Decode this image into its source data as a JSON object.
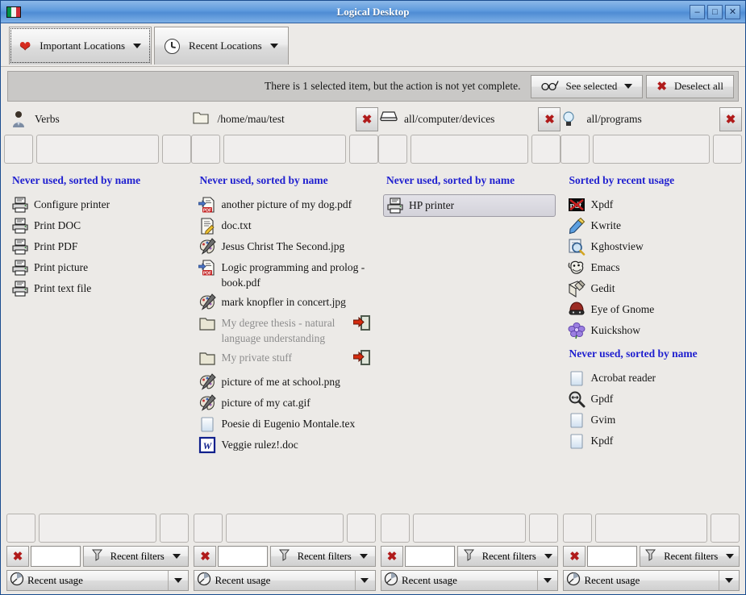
{
  "window": {
    "title": "Logical Desktop",
    "title_icon": "italian-flag-icon",
    "minimize": "–",
    "maximize": "□",
    "close": "✕"
  },
  "tabs": [
    {
      "label": "Important Locations",
      "icon": "heart-icon",
      "focused": true
    },
    {
      "label": "Recent Locations",
      "icon": "clock-icon",
      "focused": false
    }
  ],
  "status": {
    "message": "There is 1 selected item, but the action is not yet complete.",
    "see_selected": "See selected",
    "see_selected_icon": "glasses-icon",
    "deselect_all": "Deselect all",
    "deselect_icon": "red-x-icon"
  },
  "columns": [
    {
      "header": "Verbs",
      "header_icon": "user-icon",
      "has_close": false,
      "sections": [
        {
          "title": "Never used, sorted by name",
          "items": [
            {
              "label": "Configure printer",
              "icon": "printer-icon"
            },
            {
              "label": "Print DOC",
              "icon": "printer-icon"
            },
            {
              "label": "Print PDF",
              "icon": "printer-icon"
            },
            {
              "label": "Print picture",
              "icon": "printer-icon"
            },
            {
              "label": "Print text file",
              "icon": "printer-icon"
            }
          ]
        }
      ]
    },
    {
      "header": "/home/mau/test",
      "header_icon": "folder-icon",
      "has_close": true,
      "sections": [
        {
          "title": "Never used, sorted by name",
          "items": [
            {
              "label": "another picture of my dog.pdf",
              "icon": "pdf-icon"
            },
            {
              "label": "doc.txt",
              "icon": "text-edit-icon"
            },
            {
              "label": "Jesus Christ The Second.jpg",
              "icon": "palette-icon"
            },
            {
              "label": "Logic programming and prolog - book.pdf",
              "icon": "pdf-icon"
            },
            {
              "label": "mark knopfler in concert.jpg",
              "icon": "palette-icon"
            },
            {
              "label": "My degree thesis - natural language understanding",
              "icon": "folder-icon",
              "dim": true,
              "side_icon": "enter-folder-icon"
            },
            {
              "label": "My private stuff",
              "icon": "folder-icon",
              "dim": true,
              "side_icon": "enter-folder-icon"
            },
            {
              "label": "picture of me at school.png",
              "icon": "palette-icon"
            },
            {
              "label": "picture of my cat.gif",
              "icon": "palette-icon"
            },
            {
              "label": "Poesie di Eugenio Montale.tex",
              "icon": "blank-doc-icon"
            },
            {
              "label": "Veggie rulez!.doc",
              "icon": "word-icon"
            }
          ]
        }
      ]
    },
    {
      "header": "all/computer/devices",
      "header_icon": "disk-icon",
      "has_close": true,
      "sections": [
        {
          "title": "Never used, sorted by name",
          "items": [
            {
              "label": "HP printer",
              "icon": "printer-icon",
              "selected": true
            }
          ]
        }
      ]
    },
    {
      "header": "all/programs",
      "header_icon": "lightbulb-icon",
      "has_close": true,
      "sections": [
        {
          "title": "Sorted by recent usage",
          "items": [
            {
              "label": "Xpdf",
              "icon": "xpdf-icon"
            },
            {
              "label": "Kwrite",
              "icon": "kwrite-icon"
            },
            {
              "label": "Kghostview",
              "icon": "kghostview-icon"
            },
            {
              "label": "Emacs",
              "icon": "emacs-gnu-icon"
            },
            {
              "label": "Gedit",
              "icon": "gedit-icon"
            },
            {
              "label": "Eye of Gnome",
              "icon": "eog-icon"
            },
            {
              "label": "Kuickshow",
              "icon": "kuickshow-icon"
            }
          ]
        },
        {
          "title": "Never used, sorted by name",
          "items": [
            {
              "label": "Acrobat reader",
              "icon": "blank-doc-icon"
            },
            {
              "label": "Gpdf",
              "icon": "magnifier-icon"
            },
            {
              "label": "Gvim",
              "icon": "blank-doc-icon"
            },
            {
              "label": "Kpdf",
              "icon": "blank-doc-icon"
            }
          ]
        }
      ]
    }
  ],
  "footer": {
    "clear_icon": "red-x-icon",
    "filter_value": "",
    "filter_placeholder": "",
    "recent_filters": "Recent filters",
    "filter_icon": "funnel-icon",
    "recent_usage": "Recent usage",
    "usage_icon": "clock-pie-icon"
  },
  "colors": {
    "section_title": "#1f1fcf",
    "titlebar": "#5e9add",
    "window_bg": "#eceae7",
    "status_bg": "#c9c8c6",
    "accent_red": "#b01b1b"
  }
}
